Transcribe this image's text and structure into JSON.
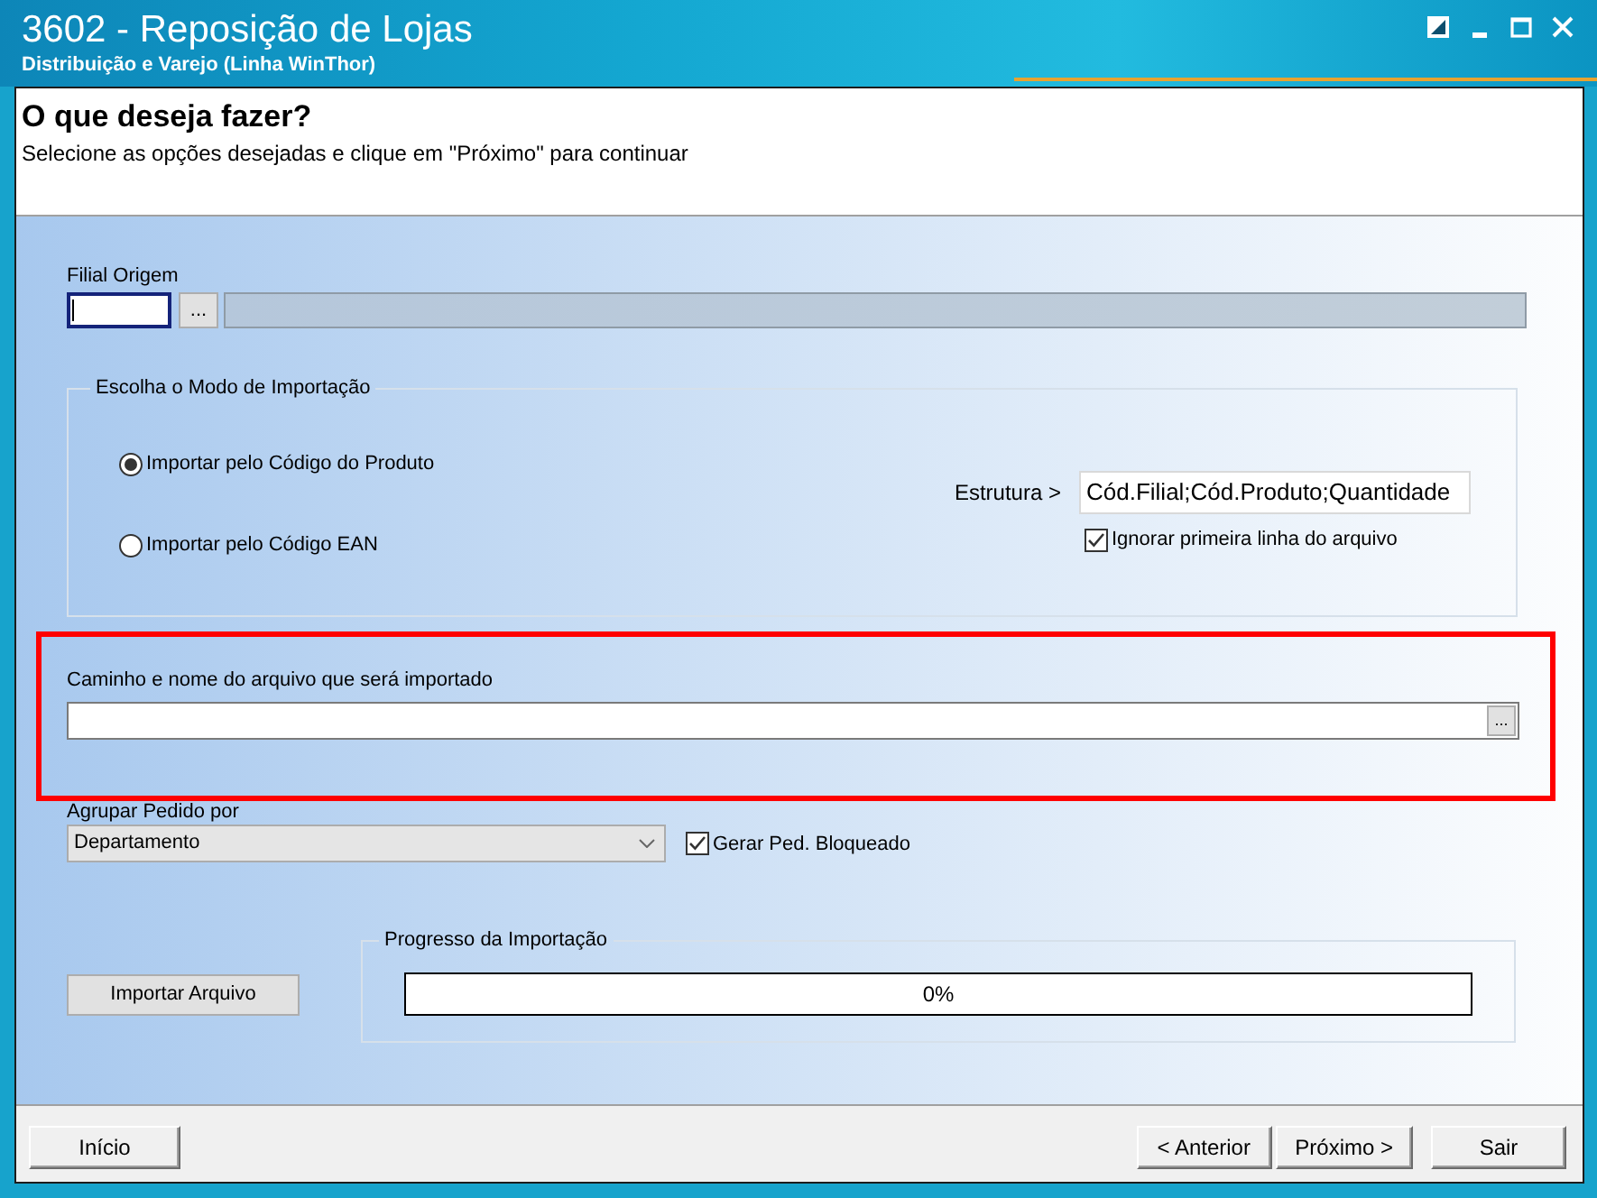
{
  "window": {
    "title": "3602 - Reposição de Lojas",
    "subtitle": "Distribuição e Varejo (Linha WinThor)"
  },
  "header": {
    "heading": "O que deseja fazer?",
    "instruction": "Selecione as opções desejadas e clique em \"Próximo\" para continuar"
  },
  "filial_origem": {
    "label": "Filial Origem",
    "focused": true,
    "lookup_button": "..."
  },
  "import_mode": {
    "legend": "Escolha o Modo de Importação",
    "options": [
      {
        "label": "Importar pelo Código do Produto",
        "selected": true
      },
      {
        "label": "Importar pelo Código EAN",
        "selected": false
      }
    ],
    "structure": {
      "label": "Estrutura >",
      "value": "Cód.Filial;Cód.Produto;Quantidade"
    },
    "skip_first_line": {
      "label": "Ignorar primeira linha do arquivo",
      "checked": true
    }
  },
  "file_path": {
    "label": "Caminho e nome do arquivo que será importado",
    "browse_button": "...",
    "highlighted": true
  },
  "group_by": {
    "label": "Agrupar Pedido por",
    "value": "Departamento"
  },
  "blocked_order": {
    "label": "Gerar Ped. Bloqueado",
    "checked": true
  },
  "import_button": {
    "label": "Importar Arquivo"
  },
  "progress": {
    "legend": "Progresso da Importação",
    "level": 0,
    "reading": "0%"
  },
  "footer": {
    "left_buttons": [
      {
        "label": "Início"
      }
    ],
    "right_buttons": [
      {
        "label": "< Anterior"
      },
      {
        "label": "Próximo >"
      },
      {
        "label": "Sair"
      }
    ]
  }
}
